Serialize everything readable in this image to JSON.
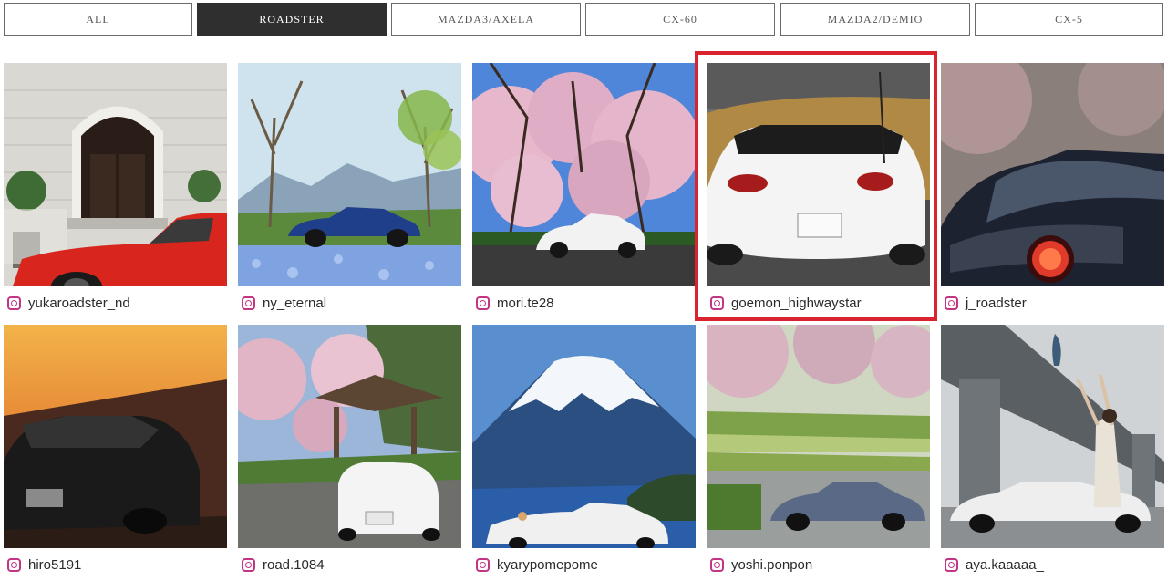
{
  "tabs": [
    {
      "label": "ALL",
      "active": false
    },
    {
      "label": "ROADSTER",
      "active": true
    },
    {
      "label": "MAZDA3/AXELA",
      "active": false
    },
    {
      "label": "CX-60",
      "active": false
    },
    {
      "label": "MAZDA2/DEMIO",
      "active": false
    },
    {
      "label": "CX-5",
      "active": false
    }
  ],
  "posts": [
    {
      "user": "yukaroadster_nd",
      "car_color": "#d8261f",
      "scene": "building"
    },
    {
      "user": "ny_eternal",
      "car_color": "#1f3f8a",
      "scene": "mountain-flowers"
    },
    {
      "user": "mori.te28",
      "car_color": "#f2f2f2",
      "scene": "cherry-blossom"
    },
    {
      "user": "goemon_highwaystar",
      "car_color": "#f4f4f4",
      "scene": "rear-hill",
      "highlighted": true
    },
    {
      "user": "j_roadster",
      "car_color": "#1c2230",
      "scene": "taillight"
    },
    {
      "user": "hiro5191",
      "car_color": "#1a1a1a",
      "scene": "sunset"
    },
    {
      "user": "road.1084",
      "car_color": "#f4f4f4",
      "scene": "gazebo"
    },
    {
      "user": "kyarypomepome",
      "car_color": "#f0f0f0",
      "scene": "mt-fuji"
    },
    {
      "user": "yoshi.ponpon",
      "car_color": "#5a6a86",
      "scene": "garden"
    },
    {
      "user": "aya.kaaaaa_",
      "car_color": "#eeeeee",
      "scene": "bridge"
    }
  ]
}
